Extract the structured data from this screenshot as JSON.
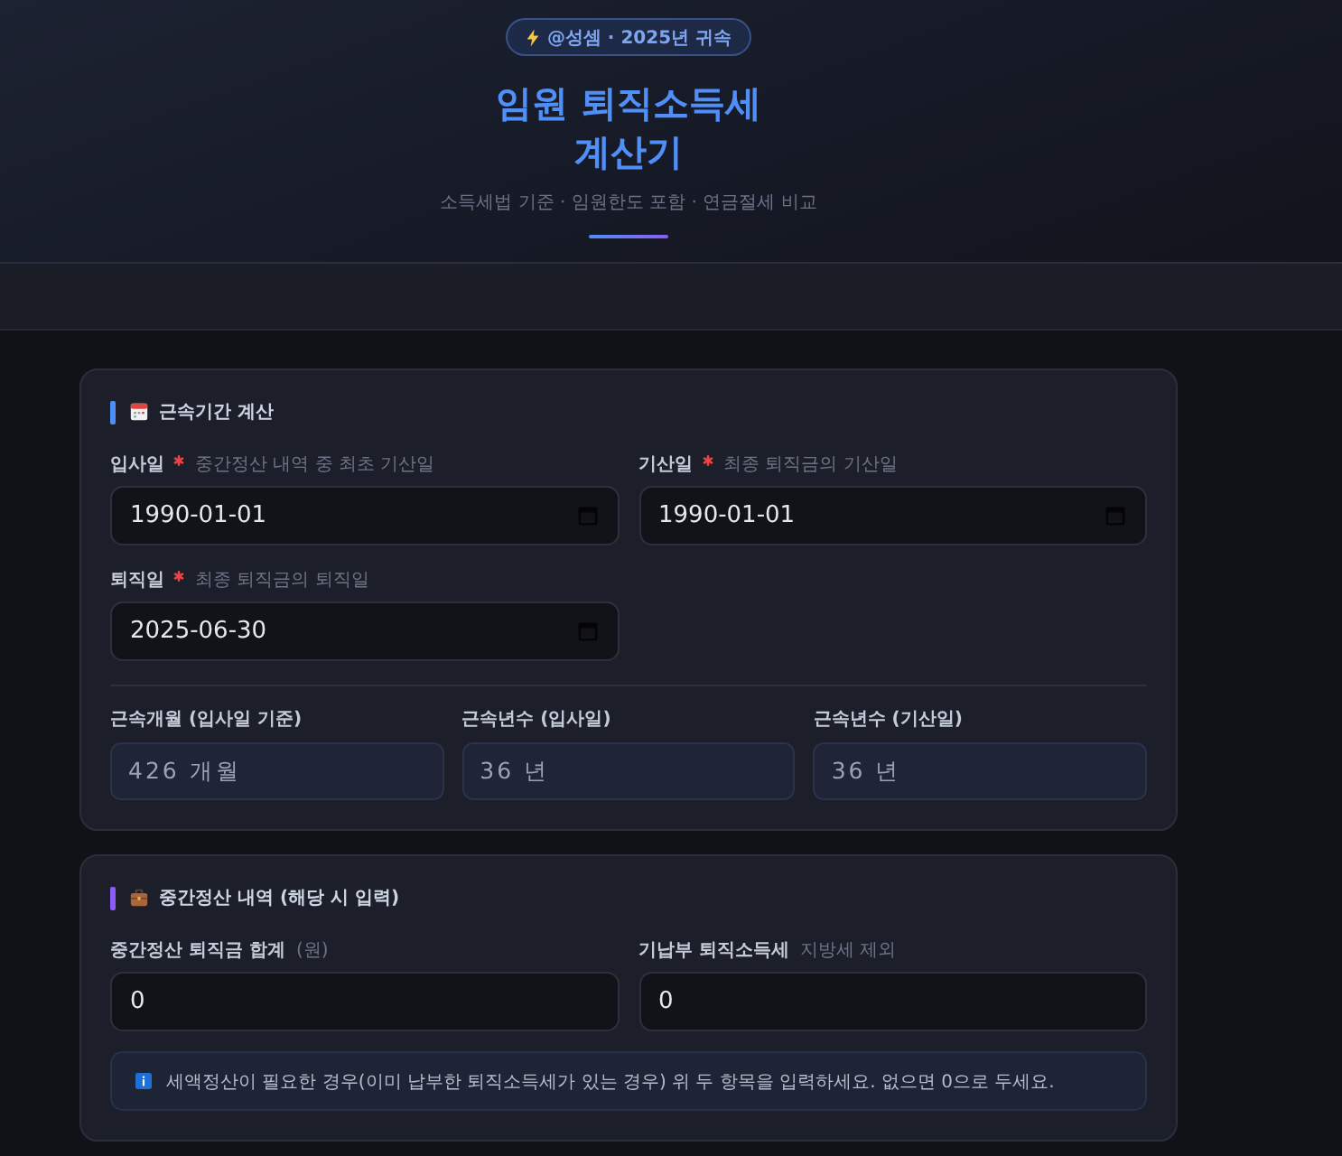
{
  "header": {
    "badge": "@성셈 · 2025년 귀속",
    "title_lines": [
      "임원 퇴직소득세",
      "계산기"
    ],
    "subtitle": "소득세법 기준 · 임원한도 포함 · 연금절세 비교"
  },
  "sections": [
    {
      "kind": "period",
      "title": "근속기간 계산",
      "color": "#4f8ef7",
      "fields": [
        {
          "kind": "date",
          "label": "입사일",
          "required": true,
          "hint": "중간정산 내역 중 최초 기산일",
          "value": "1990-01-01"
        },
        {
          "kind": "date",
          "label": "기산일",
          "required": true,
          "hint": "최종 퇴직금의 기산일",
          "value": "1990-01-01"
        },
        {
          "kind": "date",
          "label": "퇴직일",
          "required": true,
          "hint": "최종 퇴직금의 퇴직일",
          "value": "2025-06-30"
        }
      ],
      "results": [
        {
          "label": "근속개월 (입사일 기준)",
          "value": "426 개월"
        },
        {
          "label": "근속년수 (입사일)",
          "value": "36 년"
        },
        {
          "label": "근속년수 (기산일)",
          "value": "36 년"
        }
      ]
    },
    {
      "kind": "interim",
      "title": "중간정산 내역 (해당 시 입력)",
      "color": "#8b5cf6",
      "fields": [
        {
          "kind": "number",
          "label": "중간정산 퇴직금 합계",
          "required": false,
          "hint": "(원)",
          "value": "0"
        },
        {
          "kind": "number",
          "label": "기납부 퇴직소득세",
          "required": false,
          "hint": "지방세 제외",
          "value": "0"
        }
      ],
      "note": "세액정산이 필요한 경우(이미 납부한 퇴직소득세가 있는 경우) 위 두 항목을 입력하세요. 없으면 0으로 두세요."
    }
  ]
}
